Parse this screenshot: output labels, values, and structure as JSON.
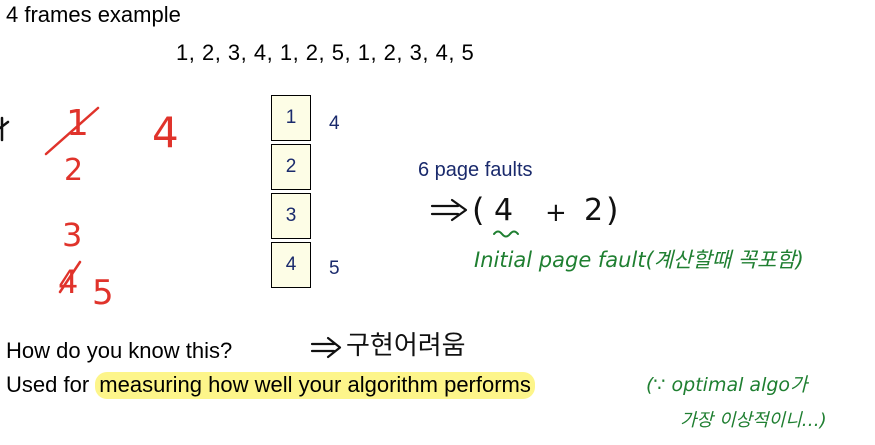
{
  "slide": {
    "title": "4 frames example",
    "reference_string": "1, 2, 3, 4, 1, 2, 5, 1, 2, 3, 4, 5",
    "frames": [
      "1",
      "2",
      "3",
      "4"
    ],
    "side_labels": {
      "row1": "4",
      "row4": "5"
    },
    "faults_text": "6 page faults",
    "question": "How do you know this?",
    "used_for_prefix": "Used for ",
    "used_for_highlight": "measuring how well your algorithm performs"
  },
  "annotations": {
    "red_row1_a": "1",
    "red_row1_b": "4",
    "red_row2": "2",
    "red_row3": "3",
    "red_row4_a": "4",
    "red_row4_b": "5",
    "breakdown_open": "(",
    "breakdown_first": "4",
    "breakdown_plus": "+",
    "breakdown_second": "2",
    "breakdown_close": ")",
    "green_note": "Initial page fault(계산할때 꼭포함)",
    "question_note": "구현어려움",
    "side_note_line1": "(∵ optimal algo가",
    "side_note_line2": "가장 이상적이니…)",
    "colors": {
      "red_ink": "#e0332b",
      "green_ink": "#1f7f31",
      "frame_fill": "#fdfde6",
      "slide_text_blue": "#1a2a6c",
      "highlight": "#fdf58a"
    }
  }
}
